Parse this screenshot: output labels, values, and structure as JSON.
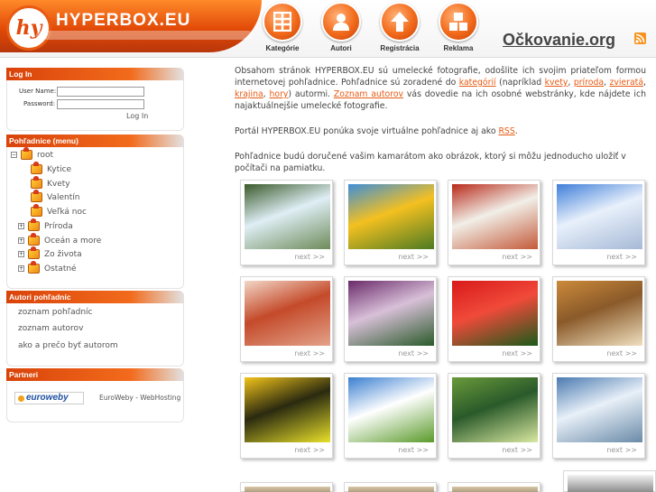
{
  "header": {
    "logo_mark": "hy",
    "site_name": "HYPERBOX.EU",
    "nav": [
      {
        "label": "Kategórie",
        "icon": "grid-icon"
      },
      {
        "label": "Autori",
        "icon": "user-icon"
      },
      {
        "label": "Registrácia",
        "icon": "arrow-up-icon"
      },
      {
        "label": "Reklama",
        "icon": "blocks-icon"
      }
    ],
    "partner_site": "Očkovanie.org",
    "rss_icon": "rss-icon"
  },
  "login": {
    "title": "Log In",
    "username_label": "User Name:",
    "password_label": "Password:",
    "button": "Log In"
  },
  "menu": {
    "title": "Pohľadnice (menu)",
    "root": "root",
    "items": [
      {
        "label": "Kytice",
        "expandable": false
      },
      {
        "label": "Kvety",
        "expandable": false
      },
      {
        "label": "Valentín",
        "expandable": false
      },
      {
        "label": "Veľká noc",
        "expandable": false
      },
      {
        "label": "Príroda",
        "expandable": true
      },
      {
        "label": "Oceán a more",
        "expandable": true
      },
      {
        "label": "Zo života",
        "expandable": true
      },
      {
        "label": "Ostatné",
        "expandable": true
      }
    ]
  },
  "authors": {
    "title": "Autori pohľadníc",
    "links": [
      "zoznam pohľadníc",
      "zoznam autorov",
      "ako a prečo byť autorom"
    ]
  },
  "partners": {
    "title": "Partneri",
    "logo_text": "euroweby",
    "text": "EuroWeby - WebHosting"
  },
  "content": {
    "intro_1": "Obsahom stránok HYPERBOX.EU sú umelecké fotografie, odošlite ich svojim priateľom formou internetovej pohľadnice. Pohľadnice sú zoradené do ",
    "link_kategorii": "kategórií",
    "intro_2": " (napríklad ",
    "link_kvety": "kvety",
    "sep1": ", ",
    "link_priroda": "príroda",
    "sep2": ", ",
    "link_zvierata": "zvieratá",
    "sep3": ", ",
    "link_krajina": "krajina",
    "sep4": ", ",
    "link_hory": "hory",
    "intro_3": ") autormi. ",
    "link_zoznam_autorov": "Zoznam autorov",
    "intro_4": " vás dovedie na ich osobné webstránky, kde nájdete ich najaktuálnejšie umelecké fotografie.",
    "p2_text": "Portál HYPERBOX.EU ponúka svoje virtuálne pohľadnice aj ako ",
    "p2_link": "RSS",
    "p2_end": ".",
    "p3": "Pohľadnice budú doručené vašim kamarátom ako obrázok, ktorý si môžu jednoducho uložiť v počítači na pamiatku.",
    "next_label": "next >>",
    "thumbnails": [
      {
        "subject": "river-rapids",
        "colors": [
          "#3a5a2a",
          "#dfeef5",
          "#6e8b5a"
        ]
      },
      {
        "subject": "sunflowers",
        "colors": [
          "#3e8fd8",
          "#f4c020",
          "#4c7a22"
        ]
      },
      {
        "subject": "red-roofs-town",
        "colors": [
          "#b82a1a",
          "#f1efe8",
          "#c45a3a"
        ]
      },
      {
        "subject": "snowy-church",
        "colors": [
          "#3f7fd9",
          "#e8f0fb",
          "#a6b9d6"
        ]
      },
      {
        "subject": "hands-sand",
        "colors": [
          "#f3d7c8",
          "#c44a2a",
          "#e3a28a"
        ]
      },
      {
        "subject": "purple-flower-drop",
        "colors": [
          "#6a2a6a",
          "#d8c0d8",
          "#2a5a2a"
        ]
      },
      {
        "subject": "red-hibiscus",
        "colors": [
          "#d81a1a",
          "#f04a3a",
          "#1a5a1a"
        ]
      },
      {
        "subject": "rope-knot",
        "colors": [
          "#cc8a3a",
          "#8a5a2a",
          "#f0e0c0"
        ]
      },
      {
        "subject": "bee-on-yellow",
        "colors": [
          "#f2c41a",
          "#2a2a10",
          "#e8e02a"
        ]
      },
      {
        "subject": "tree-field-sky",
        "colors": [
          "#3a7fd0",
          "#ffffff",
          "#5a9a2a"
        ]
      },
      {
        "subject": "hummingbird",
        "colors": [
          "#6a9a3a",
          "#2a5a2a",
          "#d8e8a0"
        ]
      },
      {
        "subject": "mountain-lake",
        "colors": [
          "#4a7ab0",
          "#e8f0f8",
          "#6a8aa8"
        ]
      }
    ]
  }
}
